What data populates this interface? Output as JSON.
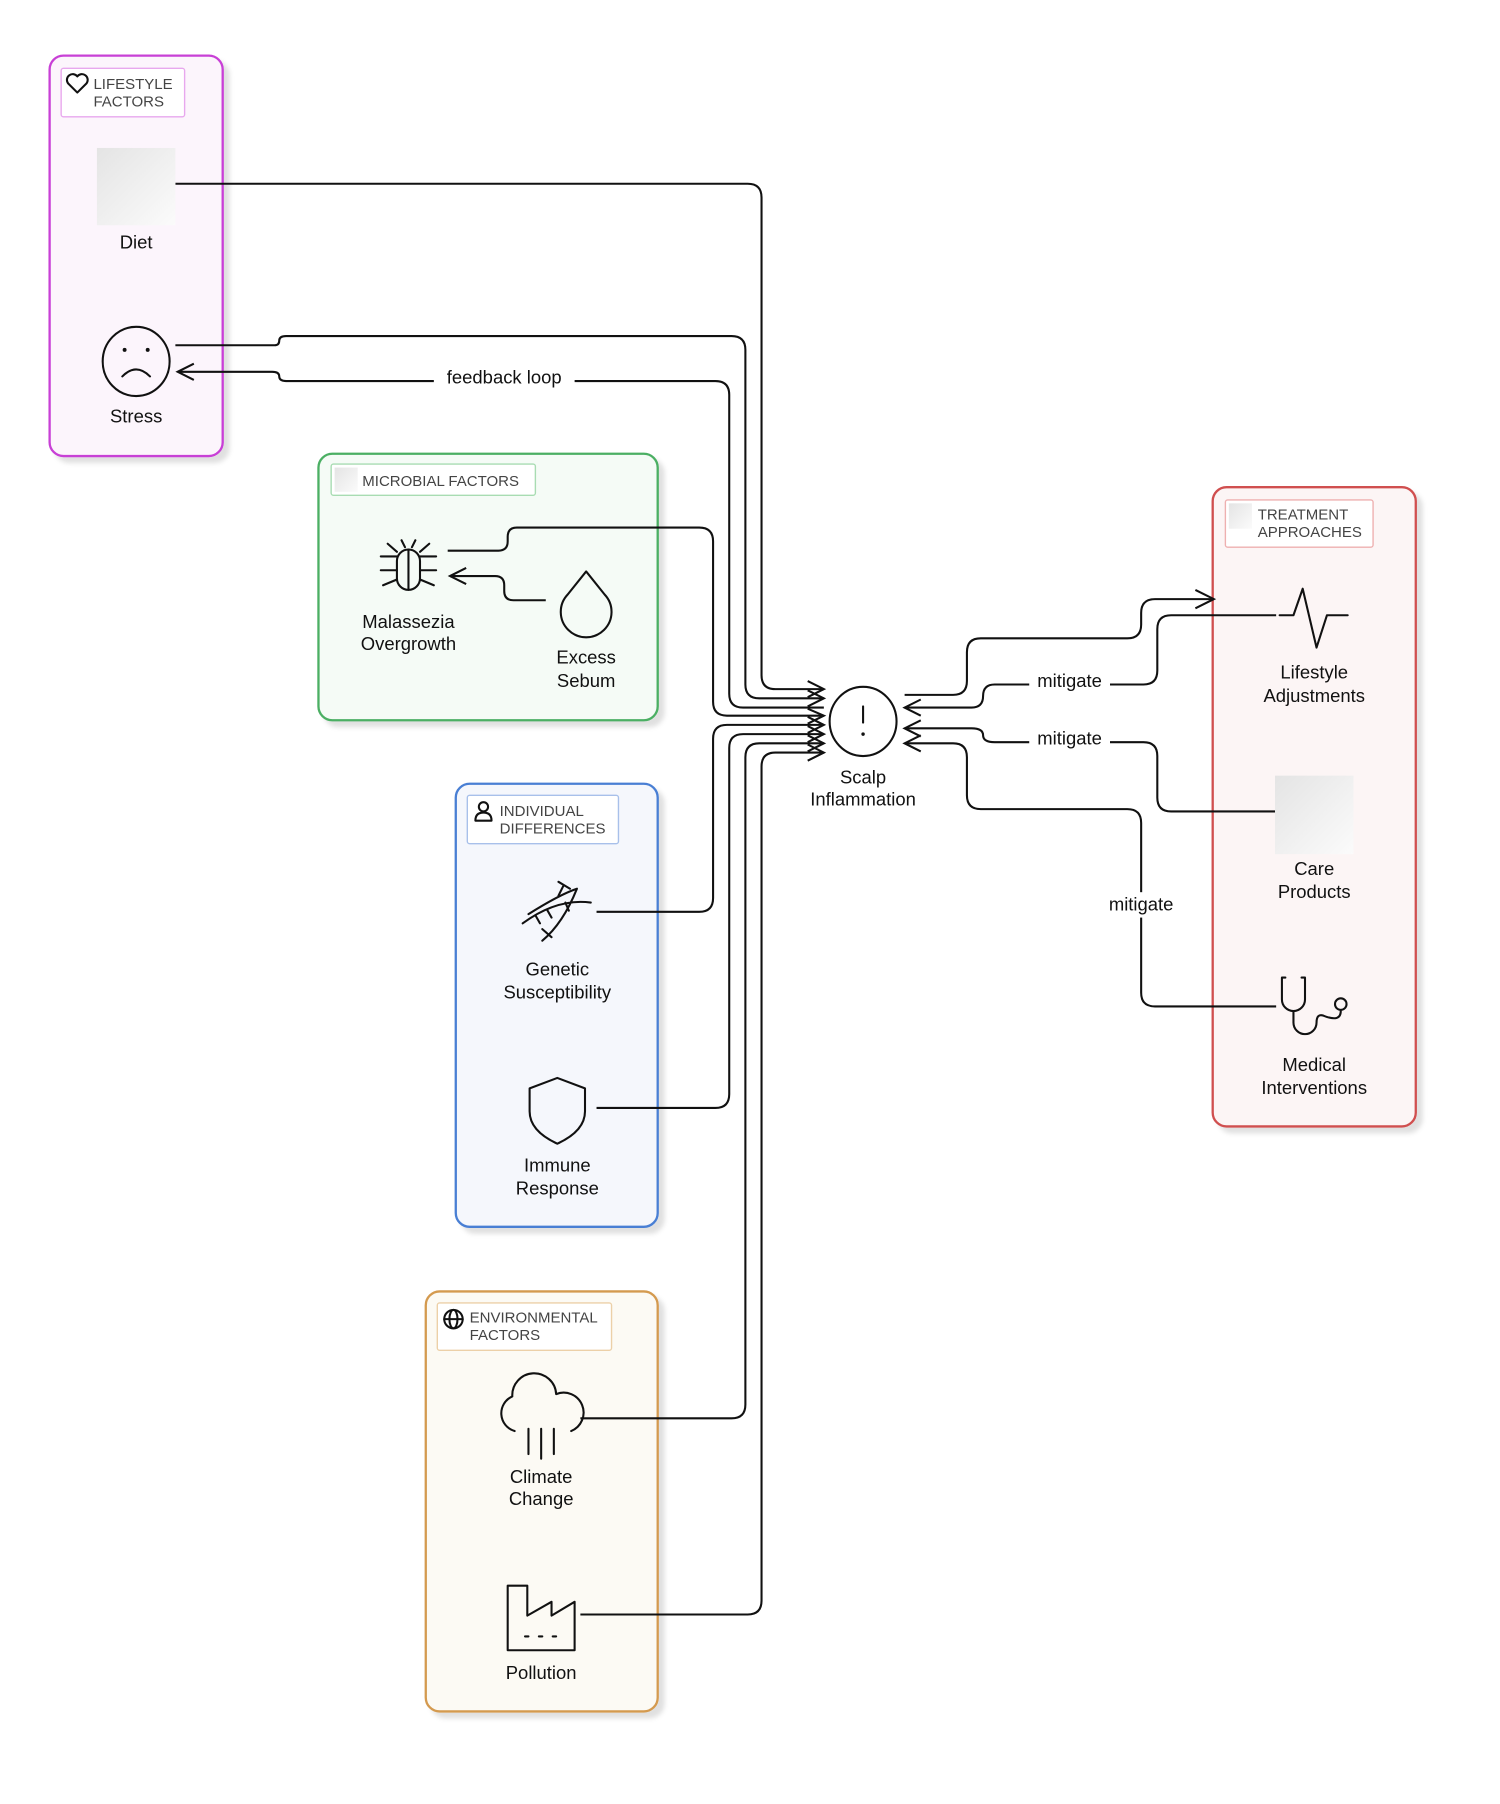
{
  "groups": {
    "lifestyle": {
      "title_line1": "LIFESTYLE",
      "title_line2": "FACTORS",
      "icon": "heart-icon",
      "color": "#c83fd6",
      "fill": "#fcf5fc"
    },
    "microbial": {
      "title": "MICROBIAL FACTORS",
      "color": "#4caf64",
      "fill": "#f5fbf6"
    },
    "individual": {
      "title_line1": "INDIVIDUAL",
      "title_line2": "DIFFERENCES",
      "icon": "user-icon",
      "color": "#4a7fd4",
      "fill": "#f5f7fc"
    },
    "environmental": {
      "title_line1": "ENVIRONMENTAL",
      "title_line2": "FACTORS",
      "icon": "globe-icon",
      "color": "#d49a50",
      "fill": "#fcfaf4"
    },
    "treatment": {
      "title_line1": "TREATMENT",
      "title_line2": "APPROACHES",
      "color": "#d05050",
      "fill": "#fcf5f5"
    }
  },
  "nodes": {
    "diet": {
      "label": "Diet",
      "icon": "image-placeholder"
    },
    "stress": {
      "label": "Stress",
      "icon": "sad-face-icon"
    },
    "malassezia": {
      "line1": "Malassezia",
      "line2": "Overgrowth",
      "icon": "bug-icon"
    },
    "sebum": {
      "line1": "Excess",
      "line2": "Sebum",
      "icon": "droplet-icon"
    },
    "scalp": {
      "line1": "Scalp",
      "line2": "Inflammation",
      "icon": "alert-circle-icon"
    },
    "genetic": {
      "line1": "Genetic",
      "line2": "Susceptibility",
      "icon": "dna-icon"
    },
    "immune": {
      "line1": "Immune",
      "line2": "Response",
      "icon": "shield-icon"
    },
    "climate": {
      "line1": "Climate",
      "line2": "Change",
      "icon": "cloud-rain-icon"
    },
    "pollution": {
      "label": "Pollution",
      "icon": "factory-icon"
    },
    "lifestyle_adj": {
      "line1": "Lifestyle",
      "line2": "Adjustments",
      "icon": "activity-icon"
    },
    "care": {
      "line1": "Care",
      "line2": "Products",
      "icon": "image-placeholder"
    },
    "medical": {
      "line1": "Medical",
      "line2": "Interventions",
      "icon": "stethoscope-icon"
    }
  },
  "edges": {
    "feedback_label": "feedback loop",
    "mitigate_1": "mitigate",
    "mitigate_2": "mitigate",
    "mitigate_3": "mitigate"
  }
}
